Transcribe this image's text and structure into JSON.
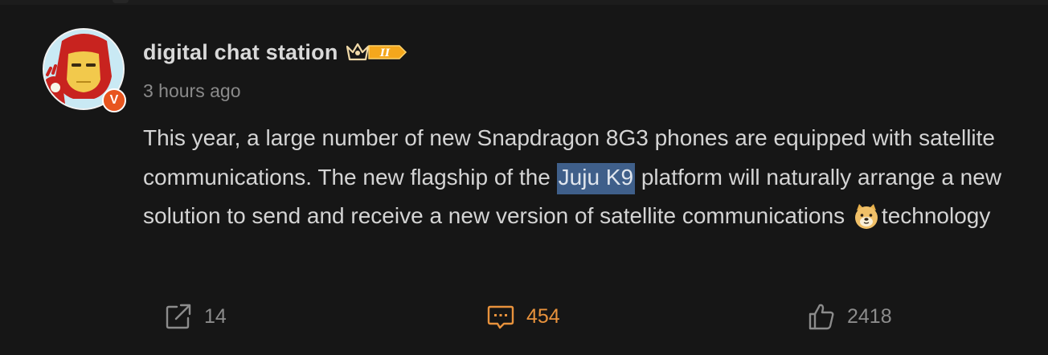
{
  "post": {
    "author": {
      "name": "digital chat station",
      "rank_badge_text": "II",
      "verified_badge": "V",
      "avatar_icon": "iron-man-avatar"
    },
    "timestamp": "3 hours ago",
    "body": {
      "part1": "This year, a large number of new Snapdragon 8G3 phones are equipped with satellite communications. The new flagship of the ",
      "highlighted": "Juju K9",
      "part2": " platform will naturally arrange a new solution to send and receive a new version of satellite communications",
      "emoji_icon": "doge-emoji",
      "part3": "technology"
    },
    "actions": {
      "share": {
        "icon": "share-icon",
        "count": "14"
      },
      "comment": {
        "icon": "comment-icon",
        "count": "454"
      },
      "like": {
        "icon": "thumbs-up-icon",
        "count": "2418"
      }
    }
  },
  "colors": {
    "background": "#161616",
    "highlight": "#3f5f8a",
    "comment_accent": "#e8923c",
    "badge_orange": "#e8551f"
  }
}
